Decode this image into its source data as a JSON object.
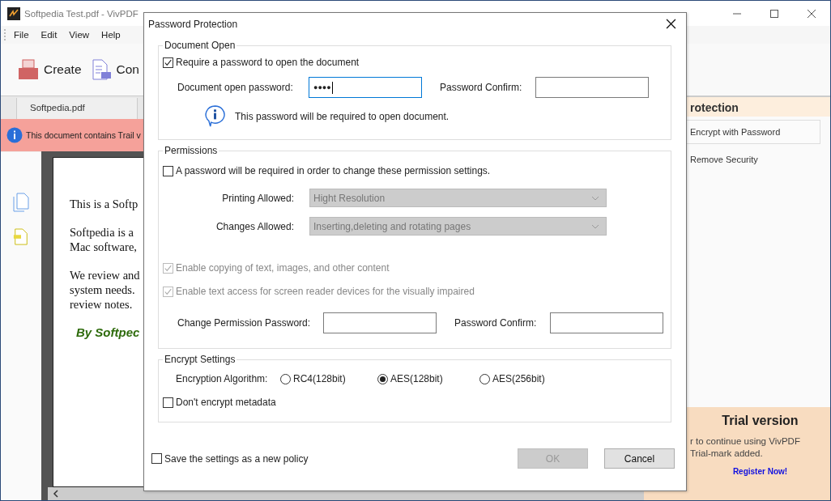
{
  "app": {
    "title": "Softpedia Test.pdf - VivPDF",
    "menu": [
      "File",
      "Edit",
      "View",
      "Help"
    ],
    "toolbar": [
      {
        "label": "Create",
        "kind": "create"
      },
      {
        "label": "Con",
        "kind": "convert"
      }
    ],
    "tabs": [
      {
        "label": "Softpedia.pdf",
        "selected": true
      }
    ],
    "notice": "This document contains Trail v",
    "document": {
      "paragraphs": [
        [
          "This is a Softp"
        ],
        [
          "Softpedia is a",
          "Mac software,"
        ],
        [
          "We review and",
          "system needs.",
          "review notes."
        ]
      ],
      "signature": "By Softpec"
    },
    "side_panel": {
      "title": "rotection",
      "items": [
        {
          "label": "Encrypt with Password",
          "selected": true
        },
        {
          "label": "Remove Security",
          "selected": false
        }
      ],
      "trial": {
        "title": "Trial version",
        "lines": [
          "r to continue using VivPDF",
          "Trial-mark added."
        ],
        "link": "Register Now!"
      }
    }
  },
  "dialog": {
    "title": "Password Protection",
    "document_open": {
      "legend": "Document Open",
      "require": {
        "label": "Require a password to open the document",
        "checked": true
      },
      "password": {
        "label": "Document open password:",
        "value": "●●●●",
        "focused": true
      },
      "confirm": {
        "label": "Password Confirm:"
      },
      "hint": "This password will be required to open document."
    },
    "permissions": {
      "legend": "Permissions",
      "require": {
        "label": "A password will be required in order to change these permission settings.",
        "checked": false
      },
      "selects": [
        {
          "label": "Printing Allowed:",
          "value": "Hight Resolution",
          "disabled": true
        },
        {
          "label": "Changes Allowed:",
          "value": "Inserting,deleting and rotating pages",
          "disabled": true
        }
      ],
      "options": [
        {
          "label": "Enable copying of text, images, and other content",
          "checked": true,
          "disabled": true
        },
        {
          "label": "Enable text access for screen reader devices for the visually impaired",
          "checked": true,
          "disabled": true
        }
      ],
      "password": {
        "label": "Change Permission Password:"
      },
      "confirm": {
        "label": "Password Confirm:"
      }
    },
    "encrypt": {
      "legend": "Encrypt Settings",
      "algorithm_label": "Encryption Algorithm:",
      "algorithms": [
        {
          "label": "RC4(128bit)",
          "selected": false
        },
        {
          "label": "AES(128bit)",
          "selected": true
        },
        {
          "label": "AES(256bit)",
          "selected": false
        }
      ],
      "metadata": {
        "label": "Don't encrypt metadata",
        "checked": false
      }
    },
    "save_policy": {
      "label": "Save the settings as a new policy",
      "checked": false
    },
    "buttons": [
      {
        "label": "OK",
        "disabled": true
      },
      {
        "label": "Cancel",
        "disabled": false
      }
    ]
  }
}
